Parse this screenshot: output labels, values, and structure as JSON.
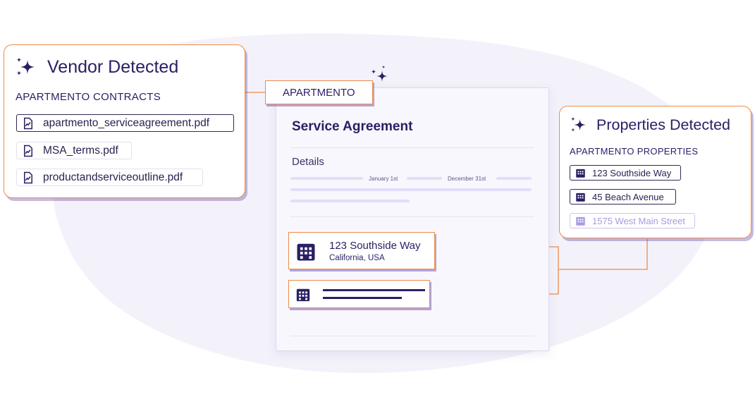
{
  "vendor_card": {
    "title": "Vendor Detected",
    "subtitle": "APARTMENTO CONTRACTS",
    "files": [
      {
        "name": "apartmento_serviceagreement.pdf"
      },
      {
        "name": "MSA_terms.pdf"
      },
      {
        "name": "productandserviceoutline.pdf"
      }
    ]
  },
  "vendor_tag": {
    "label": "APARTMENTO"
  },
  "document": {
    "title": "Service Agreement",
    "section": "Details",
    "start_date": "January 1st",
    "end_date": "December 31st",
    "address_card": {
      "street": "123 Southside Way",
      "region": "California, USA"
    }
  },
  "properties_card": {
    "title": "Properties Detected",
    "subtitle": "APARTMENTO PROPERTIES",
    "properties": [
      {
        "name": "123 Southside Way"
      },
      {
        "name": "45 Beach Avenue"
      },
      {
        "name": "1575 West Main Street"
      }
    ]
  },
  "colors": {
    "accent_orange": "#ef8a47",
    "brand_navy": "#2a1f63",
    "shadow_purple": "#5840aa",
    "faded_purple": "#a99be0"
  }
}
